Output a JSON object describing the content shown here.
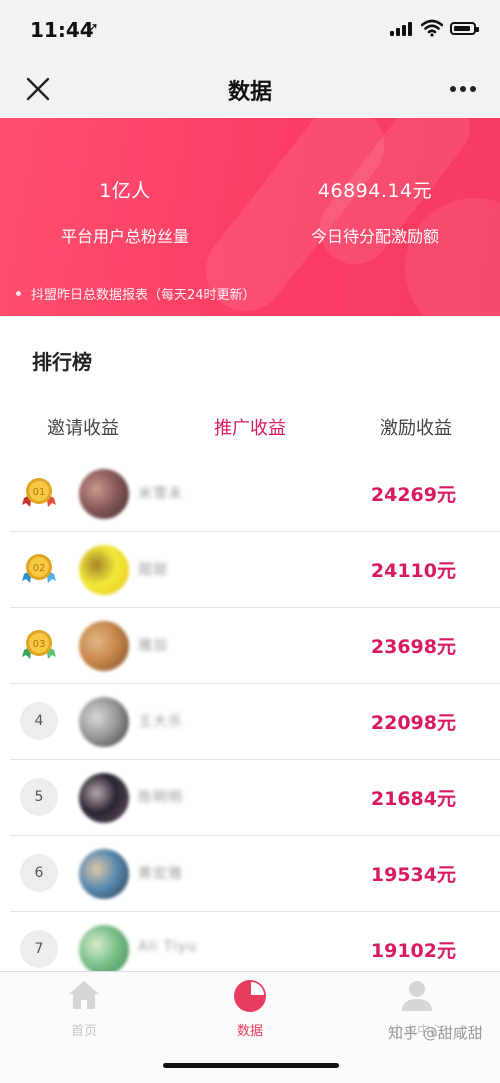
{
  "status_bar": {
    "time": "11:44"
  },
  "nav": {
    "title": "数据"
  },
  "banner": {
    "stats": [
      {
        "value": "1亿人",
        "label": "平台用户总粉丝量"
      },
      {
        "value": "46894.14元",
        "label": "今日待分配激励额"
      }
    ],
    "note": "抖盟昨日总数据报表（每天24时更新）"
  },
  "leaderboard": {
    "title": "排行榜",
    "tabs": [
      {
        "label": "邀请收益",
        "active": false
      },
      {
        "label": "推广收益",
        "active": true
      },
      {
        "label": "激励收益",
        "active": false
      }
    ],
    "rows": [
      {
        "rank": "01",
        "medal": "gold",
        "name": "米雪未",
        "amount": "24269元"
      },
      {
        "rank": "02",
        "medal": "silver",
        "name": "甜甜",
        "amount": "24110元"
      },
      {
        "rank": "03",
        "medal": "bronze",
        "name": "雅加",
        "amount": "23698元"
      },
      {
        "rank": "4",
        "medal": null,
        "name": "王大乐",
        "amount": "22098元"
      },
      {
        "rank": "5",
        "medal": null,
        "name": "陈明明",
        "amount": "21684元"
      },
      {
        "rank": "6",
        "medal": null,
        "name": "黄宏雅",
        "amount": "19534元"
      },
      {
        "rank": "7",
        "medal": null,
        "name": "Ali Tiyu",
        "amount": "19102元"
      }
    ]
  },
  "tab_bar": {
    "items": [
      {
        "label": "首页",
        "icon": "home-icon",
        "active": false
      },
      {
        "label": "数据",
        "icon": "pie-chart-icon",
        "active": true
      },
      {
        "label": "个人中心",
        "icon": "user-icon",
        "active": false
      }
    ],
    "watermark": "知乎 @甜咸甜"
  },
  "colors": {
    "accent": "#d81a63",
    "banner": "#fb3d63",
    "active_tab": "#e83b5f"
  }
}
